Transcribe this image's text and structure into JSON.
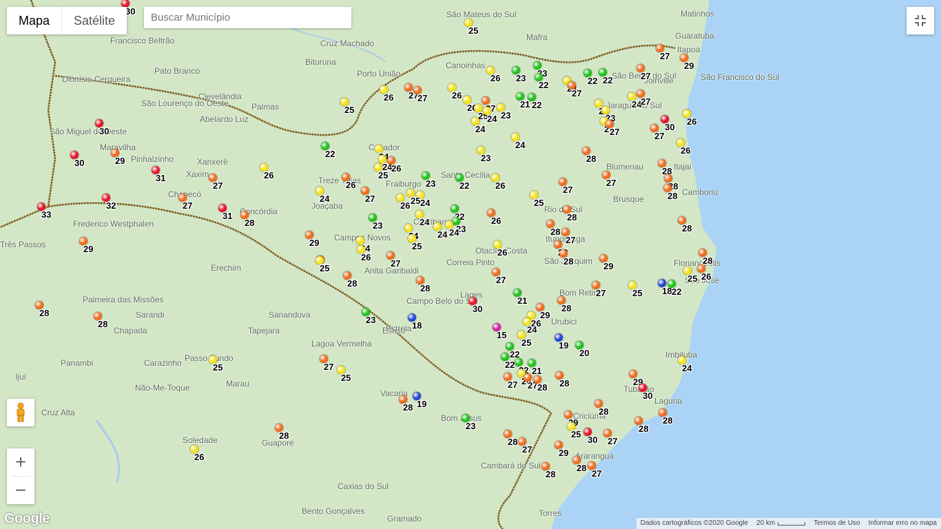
{
  "colors": {
    "red": "#e8142b",
    "orange": "#f26b1d",
    "yellow": "#f5e21b",
    "green": "#1fc21a",
    "blue": "#2246d6",
    "magenta": "#d61ea7",
    "sea": "#aad3f5",
    "land": "#d3e7c6",
    "border": "#7a5a1e"
  },
  "controls": {
    "map_types": [
      {
        "label": "Mapa",
        "active": true
      },
      {
        "label": "Satélite",
        "active": false
      }
    ],
    "search_placeholder": "Buscar Município",
    "fullscreen_icon": "exit-fullscreen-icon",
    "pegman_icon": "street-view-pegman-icon",
    "zoom_in": "+",
    "zoom_out": "−"
  },
  "footer": {
    "logo": "Google",
    "attribution": "Dados cartográficos ©2020 Google",
    "scale": "20 km",
    "terms": "Termos de Uso",
    "report": "Informar erro no mapa"
  },
  "cities": [
    "São Mateus do Sul",
    "Cruz Machado",
    "Bituruna",
    "Porto União",
    "Canoinhas",
    "Mafra",
    "Matinhos",
    "Guaratuba",
    "Itapoá",
    "Francisco Beltrão",
    "Pato Branco",
    "Dionísio Cerqueira",
    "Clevelândia",
    "Palmas",
    "São Lourenço do Oeste",
    "Abelardo Luz",
    "São Miguel do Oeste",
    "Maravilha",
    "Pinhalzinho",
    "Xanxerê",
    "Xaxim",
    "Chapecó",
    "Concórdia",
    "Joaçaba",
    "Caçador",
    "Treze Tílias",
    "Fraiburgo",
    "Santa Cecília",
    "São Bento do Sul",
    "Joinville",
    "São Francisco do Sul",
    "Jaraguá do Sul",
    "Blumenau",
    "Itajaí",
    "Camboriú",
    "Brusque",
    "Rio do Sul",
    "Ituporanga",
    "Curitibanos",
    "Campos Novos",
    "Otacílio Costa",
    "Correia Pinto",
    "Anita Garibaldi",
    "Lages",
    "Campo Belo do Sul",
    "Bom Retiro",
    "Urubici",
    "Florianópolis",
    "São José",
    "Frederico Westphalen",
    "Três Passos",
    "Erechim",
    "Palmeira das Missões",
    "Sarandi",
    "Chapada",
    "Tapejara",
    "Sananduva",
    "Lagoa Vermelha",
    "Vacaria",
    "Bom Jesus",
    "Passo Fundo",
    "Carazinho",
    "Panambi",
    "Ijuí",
    "Não-Me-Toque",
    "Marau",
    "Cruz Alta",
    "Soledade",
    "Guaporé",
    "Caxias do Sul",
    "Bento Gonçalves",
    "Gramado",
    "Cambará do Sul",
    "Criciúma",
    "Araranguá",
    "Torres",
    "Tubarão",
    "Laguna",
    "Imbituba",
    "Esteio",
    "São Joaquim",
    "Estrela"
  ],
  "stations": [
    {
      "v": "30",
      "c": "red"
    },
    {
      "v": "25",
      "c": "yellow"
    },
    {
      "v": "27",
      "c": "orange"
    },
    {
      "v": "29",
      "c": "orange"
    },
    {
      "v": "27",
      "c": "orange"
    },
    {
      "v": "26",
      "c": "yellow"
    },
    {
      "v": "26",
      "c": "yellow"
    },
    {
      "v": "23",
      "c": "green"
    },
    {
      "v": "23",
      "c": "green"
    },
    {
      "v": "22",
      "c": "green"
    },
    {
      "v": "22",
      "c": "green"
    },
    {
      "v": "22",
      "c": "green"
    },
    {
      "v": "27",
      "c": "orange"
    },
    {
      "v": "27",
      "c": "orange"
    },
    {
      "v": "23",
      "c": "yellow"
    },
    {
      "v": "27",
      "c": "orange"
    },
    {
      "v": "26",
      "c": "yellow"
    },
    {
      "v": "25",
      "c": "yellow"
    },
    {
      "v": "26",
      "c": "yellow"
    },
    {
      "v": "27",
      "c": "orange"
    },
    {
      "v": "25",
      "c": "yellow"
    },
    {
      "v": "24",
      "c": "yellow"
    },
    {
      "v": "24",
      "c": "yellow"
    },
    {
      "v": "23",
      "c": "yellow"
    },
    {
      "v": "21",
      "c": "green"
    },
    {
      "v": "22",
      "c": "green"
    },
    {
      "v": "22",
      "c": "yellow"
    },
    {
      "v": "23",
      "c": "yellow"
    },
    {
      "v": "25",
      "c": "yellow"
    },
    {
      "v": "24",
      "c": "yellow"
    },
    {
      "v": "27",
      "c": "orange"
    },
    {
      "v": "30",
      "c": "red"
    },
    {
      "v": "26",
      "c": "yellow"
    },
    {
      "v": "27",
      "c": "orange"
    },
    {
      "v": "27",
      "c": "orange"
    },
    {
      "v": "30",
      "c": "red"
    },
    {
      "v": "29",
      "c": "orange"
    },
    {
      "v": "30",
      "c": "red"
    },
    {
      "v": "31",
      "c": "red"
    },
    {
      "v": "27",
      "c": "orange"
    },
    {
      "v": "26",
      "c": "yellow"
    },
    {
      "v": "27",
      "c": "orange"
    },
    {
      "v": "32",
      "c": "red"
    },
    {
      "v": "31",
      "c": "red"
    },
    {
      "v": "28",
      "c": "orange"
    },
    {
      "v": "22",
      "c": "green"
    },
    {
      "v": "24",
      "c": "yellow"
    },
    {
      "v": "24",
      "c": "yellow"
    },
    {
      "v": "25",
      "c": "yellow"
    },
    {
      "v": "26",
      "c": "orange"
    },
    {
      "v": "27",
      "c": "orange"
    },
    {
      "v": "23",
      "c": "green"
    },
    {
      "v": "24",
      "c": "yellow"
    },
    {
      "v": "22",
      "c": "green"
    },
    {
      "v": "26",
      "c": "yellow"
    },
    {
      "v": "24",
      "c": "yellow"
    },
    {
      "v": "23",
      "c": "yellow"
    },
    {
      "v": "28",
      "c": "orange"
    },
    {
      "v": "27",
      "c": "orange"
    },
    {
      "v": "27",
      "c": "orange"
    },
    {
      "v": "28",
      "c": "orange"
    },
    {
      "v": "28",
      "c": "orange"
    },
    {
      "v": "26",
      "c": "orange"
    },
    {
      "v": "23",
      "c": "green"
    },
    {
      "v": "26",
      "c": "yellow"
    },
    {
      "v": "25",
      "c": "yellow"
    },
    {
      "v": "24",
      "c": "yellow"
    },
    {
      "v": "22",
      "c": "green"
    },
    {
      "v": "23",
      "c": "green"
    },
    {
      "v": "26",
      "c": "orange"
    },
    {
      "v": "25",
      "c": "yellow"
    },
    {
      "v": "28",
      "c": "orange"
    },
    {
      "v": "28",
      "c": "orange"
    },
    {
      "v": "27",
      "c": "orange"
    },
    {
      "v": "28",
      "c": "orange"
    },
    {
      "v": "28",
      "c": "orange"
    },
    {
      "v": "33",
      "c": "red"
    },
    {
      "v": "29",
      "c": "orange"
    },
    {
      "v": "29",
      "c": "orange"
    },
    {
      "v": "24",
      "c": "yellow"
    },
    {
      "v": "24",
      "c": "yellow"
    },
    {
      "v": "26",
      "c": "yellow"
    },
    {
      "v": "27",
      "c": "orange"
    },
    {
      "v": "29",
      "c": "orange"
    },
    {
      "v": "28",
      "c": "orange"
    },
    {
      "v": "28",
      "c": "orange"
    },
    {
      "v": "28",
      "c": "orange"
    },
    {
      "v": "26",
      "c": "yellow"
    },
    {
      "v": "24",
      "c": "yellow"
    },
    {
      "v": "24",
      "c": "yellow"
    },
    {
      "v": "24",
      "c": "yellow"
    },
    {
      "v": "25",
      "c": "yellow"
    },
    {
      "v": "26",
      "c": "yellow"
    },
    {
      "v": "27",
      "c": "orange"
    },
    {
      "v": "28",
      "c": "orange"
    },
    {
      "v": "21",
      "c": "green"
    },
    {
      "v": "30",
      "c": "red"
    },
    {
      "v": "29",
      "c": "orange"
    },
    {
      "v": "28",
      "c": "orange"
    },
    {
      "v": "27",
      "c": "orange"
    },
    {
      "v": "29",
      "c": "orange"
    },
    {
      "v": "28",
      "c": "orange"
    },
    {
      "v": "26",
      "c": "orange"
    },
    {
      "v": "25",
      "c": "yellow"
    },
    {
      "v": "25",
      "c": "yellow"
    },
    {
      "v": "18",
      "c": "blue"
    },
    {
      "v": "22",
      "c": "green"
    },
    {
      "v": "25",
      "c": "yellow"
    },
    {
      "v": "23",
      "c": "green"
    },
    {
      "v": "18",
      "c": "blue"
    },
    {
      "v": "15",
      "c": "magenta"
    },
    {
      "v": "26",
      "c": "yellow"
    },
    {
      "v": "24",
      "c": "yellow"
    },
    {
      "v": "25",
      "c": "yellow"
    },
    {
      "v": "19",
      "c": "blue"
    },
    {
      "v": "20",
      "c": "green"
    },
    {
      "v": "22",
      "c": "green"
    },
    {
      "v": "22",
      "c": "green"
    },
    {
      "v": "22",
      "c": "green"
    },
    {
      "v": "21",
      "c": "green"
    },
    {
      "v": "26",
      "c": "yellow"
    },
    {
      "v": "27",
      "c": "orange"
    },
    {
      "v": "27",
      "c": "orange"
    },
    {
      "v": "28",
      "c": "orange"
    },
    {
      "v": "28",
      "c": "orange"
    },
    {
      "v": "27",
      "c": "orange"
    },
    {
      "v": "25",
      "c": "yellow"
    },
    {
      "v": "25",
      "c": "yellow"
    },
    {
      "v": "24",
      "c": "yellow"
    },
    {
      "v": "29",
      "c": "orange"
    },
    {
      "v": "30",
      "c": "red"
    },
    {
      "v": "28",
      "c": "orange"
    },
    {
      "v": "28",
      "c": "orange"
    },
    {
      "v": "28",
      "c": "orange"
    },
    {
      "v": "29",
      "c": "orange"
    },
    {
      "v": "28",
      "c": "orange"
    },
    {
      "v": "19",
      "c": "blue"
    },
    {
      "v": "23",
      "c": "green"
    },
    {
      "v": "29",
      "c": "orange"
    },
    {
      "v": "28",
      "c": "orange"
    },
    {
      "v": "27",
      "c": "orange"
    },
    {
      "v": "28",
      "c": "orange"
    },
    {
      "v": "27",
      "c": "orange"
    },
    {
      "v": "30",
      "c": "red"
    },
    {
      "v": "25",
      "c": "yellow"
    },
    {
      "v": "28",
      "c": "orange"
    },
    {
      "v": "28",
      "c": "orange"
    },
    {
      "v": "27",
      "c": "orange"
    },
    {
      "v": "26",
      "c": "yellow"
    },
    {
      "v": "28",
      "c": "orange"
    },
    {
      "v": "28",
      "c": "orange"
    }
  ]
}
